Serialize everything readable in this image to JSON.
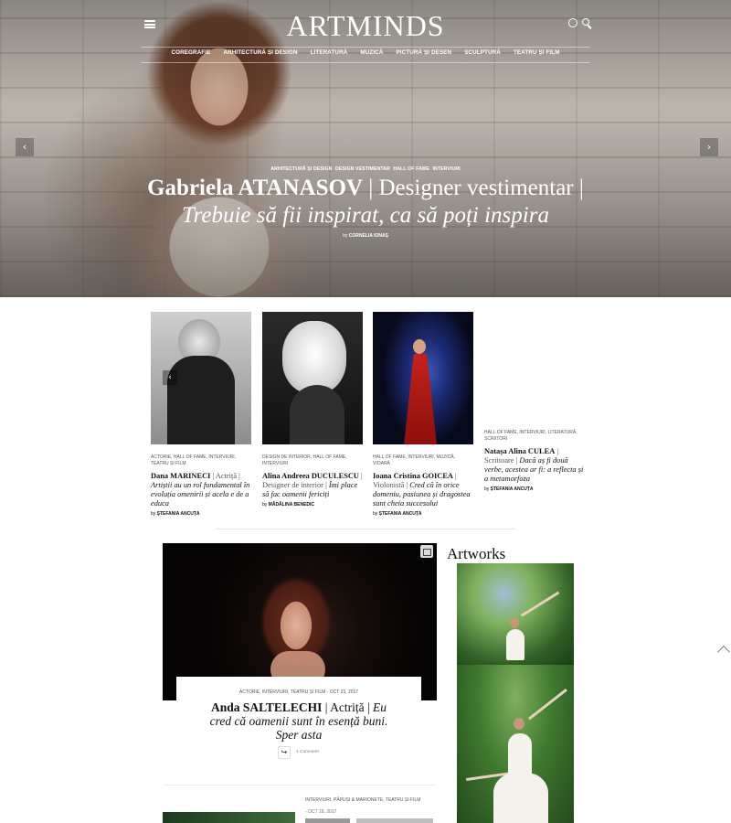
{
  "site": {
    "logo": "ARTMINDS"
  },
  "nav": {
    "items": [
      "Coregrafie",
      "Arhitectură și Design",
      "Literatură",
      "Muzică",
      "Pictură și Desen",
      "Sculptură",
      "Teatru și Film"
    ]
  },
  "hero": {
    "categories": [
      "Arhitectură și Design",
      "Design Vestimentar",
      "Hall of Fame",
      "Interviuri"
    ],
    "title_name": "Gabriela ATANASOV",
    "title_rest": " | Designer vestimentar |",
    "subtitle": "Trebuie să fii inspirat, ca să poți inspira",
    "by_prefix": "by",
    "author": "Cornelia Ionaș"
  },
  "cards": [
    {
      "meta": "Actorie, Hall of Fame, Interviuri, Teatru și Film",
      "name": "Dana MARINECI",
      "role": " | Actriță | ",
      "quote": "Artiștii au un rol fundamental în evoluția omenirii și acela e de a educa",
      "by_prefix": "by",
      "author": "Ștefania Ancuța"
    },
    {
      "meta": "Design de Interior, Hall of Fame, Interviuri",
      "name": "Alina Andreea DUCULESCU",
      "role": " | Designer de interior | ",
      "quote": "Îmi place să fac oamenii fericiți",
      "by_prefix": "by",
      "author": "Mădălina Benedic"
    },
    {
      "meta": "Hall of Fame, Interviuri, Muzică, Vioară",
      "name": "Ioana Cristina GOICEA",
      "role": " | Violonistă | ",
      "quote": "Cred că în orice domeniu, pasiunea și dragostea sunt cheia succesului",
      "by_prefix": "by",
      "author": "Ștefania Ancuța"
    },
    {
      "meta": "Hall of Fame, Interviuri, Literatură, Scriitori",
      "name": "Natașa Alina CULEA",
      "role": " | Scriitoare | ",
      "quote": "Dacă aș fi două verbe, acestea ar fi: a reflecta și a metamorfoza",
      "by_prefix": "by",
      "author": "Ștefania Ancuța"
    }
  ],
  "featured": {
    "categories": "Actorie, Interviuri, Teatru și Film",
    "date": "Oct 23, 2017",
    "name": "Anda SALTELECHI",
    "role": " | Actriță | ",
    "quote": "Eu cred că oamenii sunt în esență buni. Sper asta",
    "comments": "1 Comment"
  },
  "next_post": {
    "categories": "Interviuri, Păpuși & Marionete, Teatru și Film",
    "date": "Oct 18, 2017"
  },
  "sidebar": {
    "artworks_title": "Artworks"
  },
  "icons": {
    "menu": "menu-icon",
    "globe": "globe-icon",
    "search": "search-icon",
    "prev": "chevron-left-icon",
    "next": "chevron-right-icon",
    "gallery": "gallery-icon",
    "share": "share-icon",
    "back_to_top": "chevron-up-icon"
  },
  "colors": {
    "text": "#111111",
    "muted": "#555555",
    "hero_text": "#ffffff"
  }
}
